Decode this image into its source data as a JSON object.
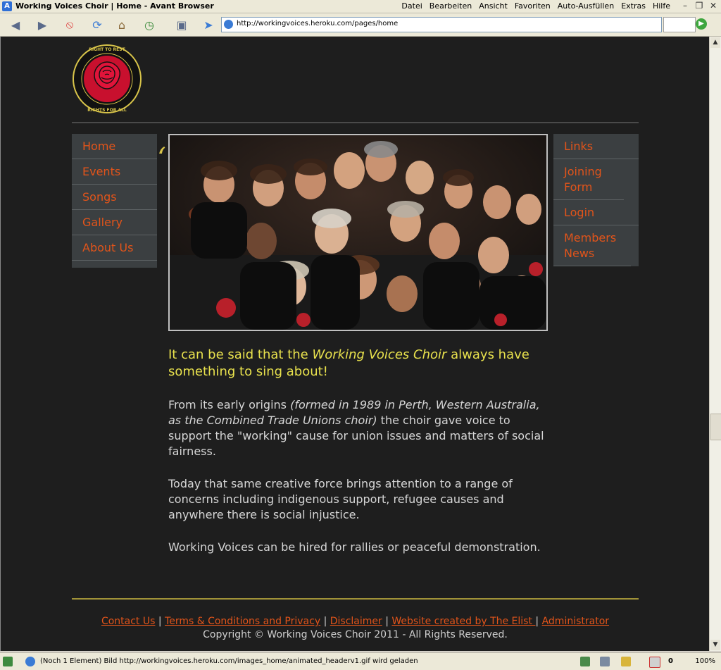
{
  "window": {
    "title": "Working Voices Choir | Home - Avant Browser",
    "menu": [
      "Datei",
      "Bearbeiten",
      "Ansicht",
      "Favoriten",
      "Auto-Ausfüllen",
      "Extras",
      "Hilfe"
    ]
  },
  "toolbar": {
    "address": "http://workingvoices.heroku.com/pages/home"
  },
  "site": {
    "logo_text": "RIGHT TO WORK · RIGHT TO REST · RIGHT TO PLAY · RIGHTS FOR ALL",
    "nav_left": [
      "Home",
      "Events",
      "Songs",
      "Gallery",
      "About Us"
    ],
    "nav_right_1": "Links",
    "nav_right_2": "Joining Form",
    "nav_right_3": "Login",
    "nav_right_4": "Members News",
    "lead_prefix": "It can be said that the ",
    "lead_em": "Working Voices Choir",
    "lead_suffix": " always have something to sing about!",
    "para1_prefix": "From its early origins ",
    "para1_em": "(formed in 1989 in Perth, Western Australia, as the Combined Trade Unions choir)",
    "para1_suffix": " the choir gave voice to support the \"working\" cause for union issues and matters of social fairness.",
    "para2": "Today that same creative force brings attention to a range of concerns including indigenous support, refugee causes and anywhere there is social injustice.",
    "para3": "Working Voices can be hired for rallies or peaceful demonstration.",
    "footer_links": [
      "Contact Us",
      "Terms & Conditions and Privacy",
      "Disclaimer",
      "Website created by The Elist ",
      "Administrator"
    ],
    "copyright": "Copyright © Working Voices Choir 2011 - All Rights Reserved."
  },
  "status": {
    "text": "(Noch 1 Element) Bild http://workingvoices.heroku.com/images_home/animated_headerv1.gif wird geladen",
    "count": "0",
    "zoom": "100%"
  },
  "colors": {
    "page_bg": "#1e1e1e",
    "nav_bg": "#3b3f41",
    "link": "#e2541a",
    "lead": "#e8e14d"
  }
}
